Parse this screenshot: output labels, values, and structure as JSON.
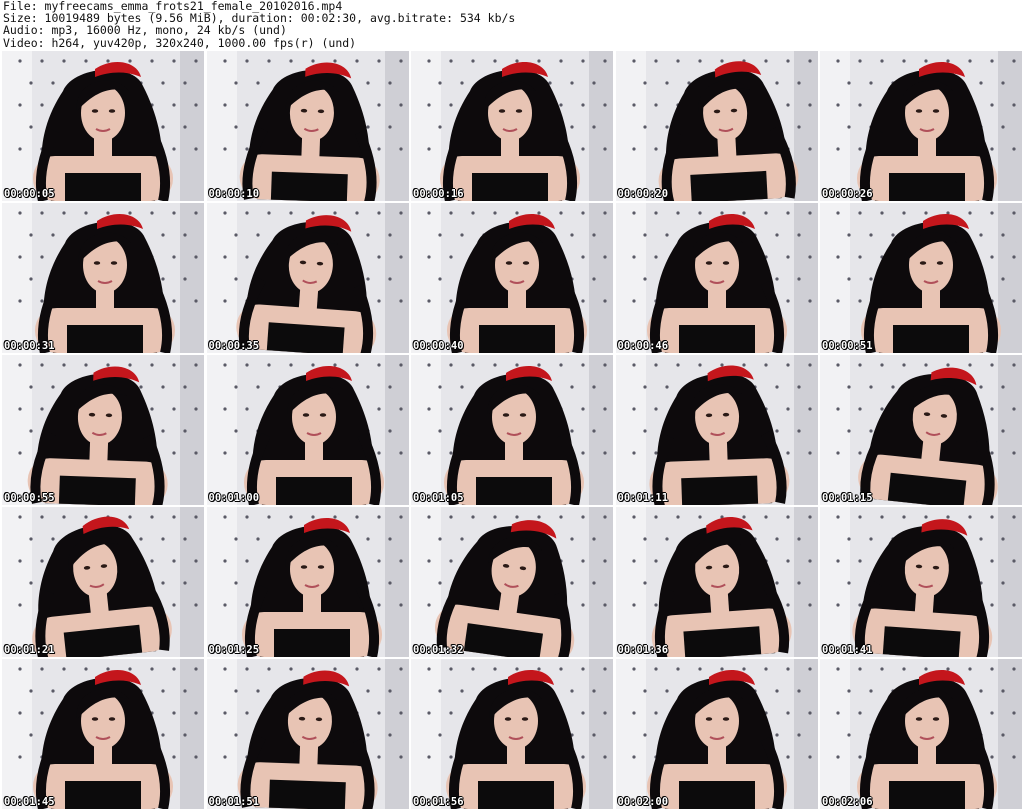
{
  "header": {
    "file": "File: myfreecams_emma_frots21_female_20102016.mp4",
    "size": "Size: 10019489 bytes (9.56 MiB), duration: 00:02:30, avg.bitrate: 534 kb/s",
    "audio": "Audio: mp3, 16000 Hz, mono, 24 kb/s (und)",
    "video": "Video: h264, yuv420p, 320x240, 1000.00 fps(r) (und)"
  },
  "colors": {
    "headboard": "#e6e6ea",
    "tufting": "#5a5a66",
    "hair": "#0d0a0c",
    "skin": "#e8c4b4",
    "bandana": "#c4161c",
    "top": "#0c0b0c",
    "wall_left": "#f2f2f4"
  },
  "thumbnails": [
    {
      "timestamp": "00:00:05",
      "image": "woman-with-red-bandana-frame"
    },
    {
      "timestamp": "00:00:10",
      "image": "woman-with-red-bandana-frame"
    },
    {
      "timestamp": "00:00:16",
      "image": "woman-with-red-bandana-frame"
    },
    {
      "timestamp": "00:00:20",
      "image": "woman-with-red-bandana-frame"
    },
    {
      "timestamp": "00:00:26",
      "image": "woman-with-red-bandana-frame"
    },
    {
      "timestamp": "00:00:31",
      "image": "woman-with-red-bandana-frame"
    },
    {
      "timestamp": "00:00:35",
      "image": "woman-with-red-bandana-frame"
    },
    {
      "timestamp": "00:00:40",
      "image": "woman-with-red-bandana-frame"
    },
    {
      "timestamp": "00:00:46",
      "image": "woman-with-red-bandana-frame"
    },
    {
      "timestamp": "00:00:51",
      "image": "woman-with-red-bandana-frame"
    },
    {
      "timestamp": "00:00:55",
      "image": "woman-with-red-bandana-frame"
    },
    {
      "timestamp": "00:01:00",
      "image": "woman-with-red-bandana-frame"
    },
    {
      "timestamp": "00:01:05",
      "image": "woman-with-red-bandana-frame"
    },
    {
      "timestamp": "00:01:11",
      "image": "woman-with-red-bandana-frame"
    },
    {
      "timestamp": "00:01:15",
      "image": "woman-with-red-bandana-frame"
    },
    {
      "timestamp": "00:01:21",
      "image": "woman-with-red-bandana-frame"
    },
    {
      "timestamp": "00:01:25",
      "image": "woman-with-red-bandana-frame"
    },
    {
      "timestamp": "00:01:32",
      "image": "woman-with-red-bandana-frame"
    },
    {
      "timestamp": "00:01:36",
      "image": "woman-with-red-bandana-frame"
    },
    {
      "timestamp": "00:01:41",
      "image": "woman-with-red-bandana-frame"
    },
    {
      "timestamp": "00:01:45",
      "image": "woman-with-red-bandana-frame"
    },
    {
      "timestamp": "00:01:51",
      "image": "woman-with-red-bandana-frame"
    },
    {
      "timestamp": "00:01:56",
      "image": "woman-with-red-bandana-frame"
    },
    {
      "timestamp": "00:02:00",
      "image": "woman-with-red-bandana-frame"
    },
    {
      "timestamp": "00:02:06",
      "image": "woman-with-red-bandana-frame"
    }
  ]
}
